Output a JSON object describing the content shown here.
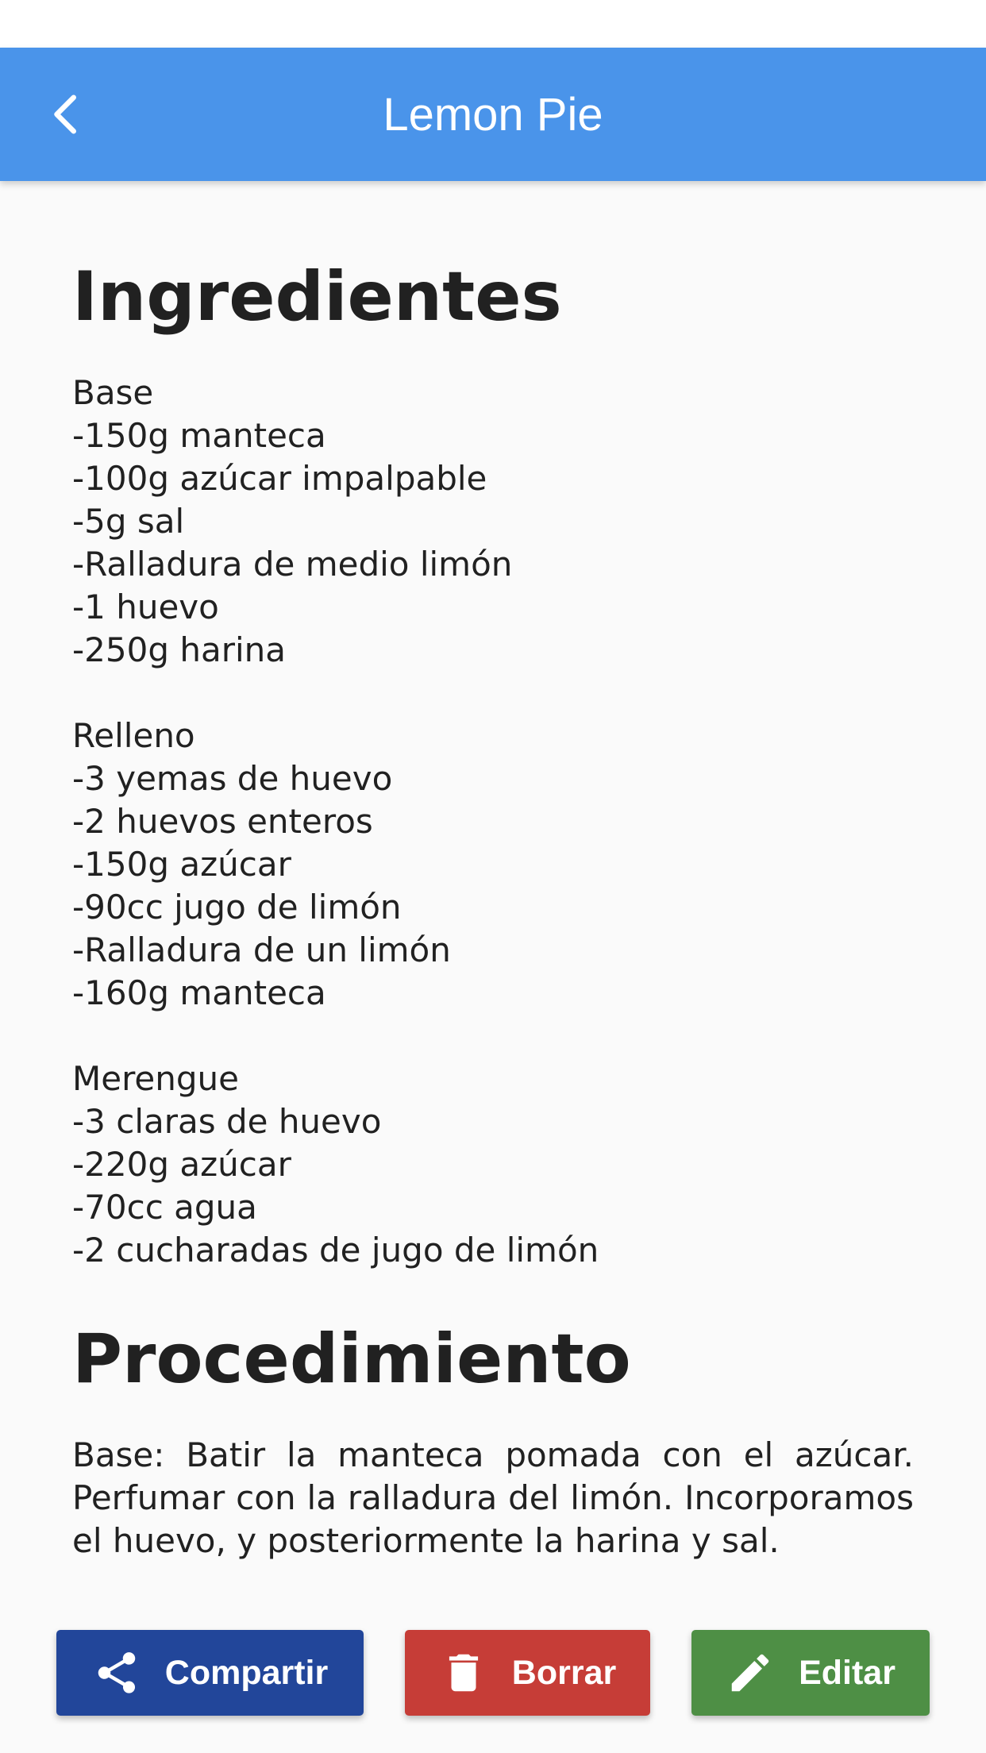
{
  "app_bar": {
    "title": "Lemon Pie",
    "back_icon": "chevron-left-icon",
    "background_color": "#4a94ea"
  },
  "ingredients": {
    "heading": "Ingredientes",
    "groups": [
      {
        "title": "Base",
        "items": [
          "-150g manteca",
          "-100g azúcar impalpable",
          "-5g sal",
          "-Ralladura de medio limón",
          "-1 huevo",
          "-250g harina"
        ]
      },
      {
        "title": "Relleno",
        "items": [
          "-3 yemas de huevo",
          "-2 huevos enteros",
          "-150g azúcar",
          "-90cc jugo de limón",
          "-Ralladura de un limón",
          "-160g manteca"
        ]
      },
      {
        "title": "Merengue",
        "items": [
          "-3 claras de huevo",
          "-220g azúcar",
          "-70cc agua",
          "-2 cucharadas de jugo de limón"
        ]
      }
    ]
  },
  "procedure": {
    "heading": "Procedimiento",
    "text": "Base: Batir la manteca pomada con el azúcar. Perfumar con la ralladura del limón. Incorporamos el huevo, y posteriormente la harina y sal."
  },
  "actions": {
    "share": {
      "label": "Compartir",
      "icon": "share-icon",
      "color": "#22469a"
    },
    "delete": {
      "label": "Borrar",
      "icon": "trash-icon",
      "color": "#c63d37"
    },
    "edit": {
      "label": "Editar",
      "icon": "pencil-icon",
      "color": "#4e8f45"
    }
  }
}
